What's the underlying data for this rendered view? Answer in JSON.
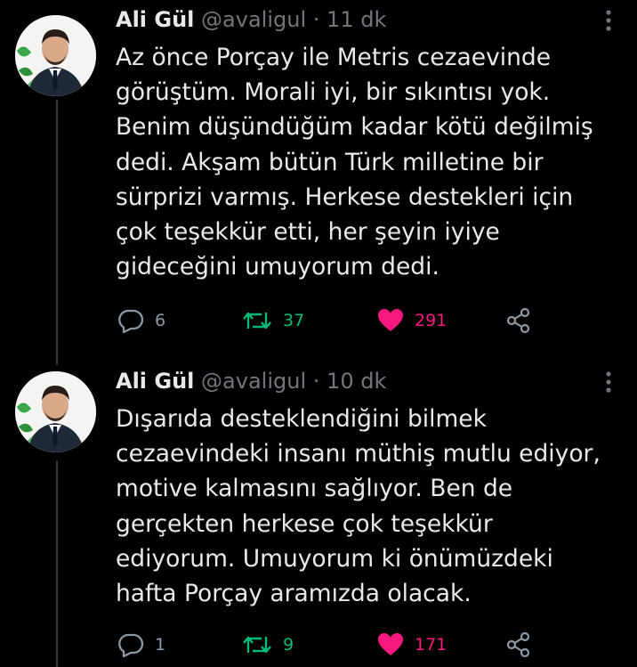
{
  "colors": {
    "background": "#000000",
    "text": "#e7e9ea",
    "muted": "#71767b",
    "retweet": "#00ba7c",
    "like": "#f91880",
    "thread_line": "#333639"
  },
  "tweets": [
    {
      "name": "Ali Gül",
      "handle": "@avaligul",
      "separator": "·",
      "time": "11 dk",
      "lines": [
        "Az önce Porçay ile Metris cezaevinde",
        "görüştüm. Morali iyi, bir sıkıntısı yok.",
        "Benim düşündüğüm kadar kötü değilmiş",
        "dedi. Akşam bütün Türk milletine bir",
        "sürprizi varmış. Herkese destekleri için",
        "çok teşekkür etti, her şeyin iyiye",
        "gideceğini umuyorum dedi."
      ],
      "replies": "6",
      "retweets": "37",
      "likes": "291",
      "icons": {
        "reply": "reply-icon",
        "retweet": "retweet-icon",
        "like": "heart-filled-icon",
        "share": "share-icon",
        "more": "more-icon"
      }
    },
    {
      "name": "Ali Gül",
      "handle": "@avaligul",
      "separator": "·",
      "time": "10 dk",
      "lines": [
        "Dışarıda desteklendiğini bilmek",
        "cezaevindeki insanı müthiş mutlu ediyor,",
        "motive kalmasını sağlıyor. Ben de",
        "gerçekten herkese çok teşekkür",
        "ediyorum. Umuyorum ki önümüzdeki",
        "hafta Porçay aramızda olacak."
      ],
      "replies": "1",
      "retweets": "9",
      "likes": "171",
      "icons": {
        "reply": "reply-icon",
        "retweet": "retweet-icon",
        "like": "heart-filled-icon",
        "share": "share-icon",
        "more": "more-icon"
      }
    }
  ]
}
